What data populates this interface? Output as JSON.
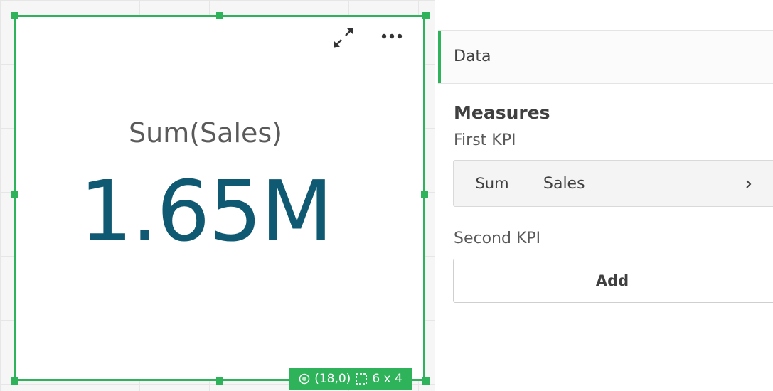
{
  "kpi": {
    "label": "Sum(Sales)",
    "value": "1.65M",
    "status_position": "(18,0)",
    "status_size": "6 x 4"
  },
  "panel": {
    "tab_label": "Data",
    "measures_title": "Measures",
    "first_kpi_label": "First KPI",
    "first_kpi_aggregation": "Sum",
    "first_kpi_field": "Sales",
    "second_kpi_label": "Second KPI",
    "add_label": "Add"
  },
  "icons": {
    "expand": "expand-arrows-icon",
    "more": "more-horizontal-icon",
    "position": "target-icon",
    "size": "dashed-box-icon",
    "chevron": "chevron-right-icon"
  },
  "colors": {
    "selection_green": "#2fb35a",
    "kpi_value": "#0f5a72",
    "label_gray": "#5a5a5a"
  }
}
